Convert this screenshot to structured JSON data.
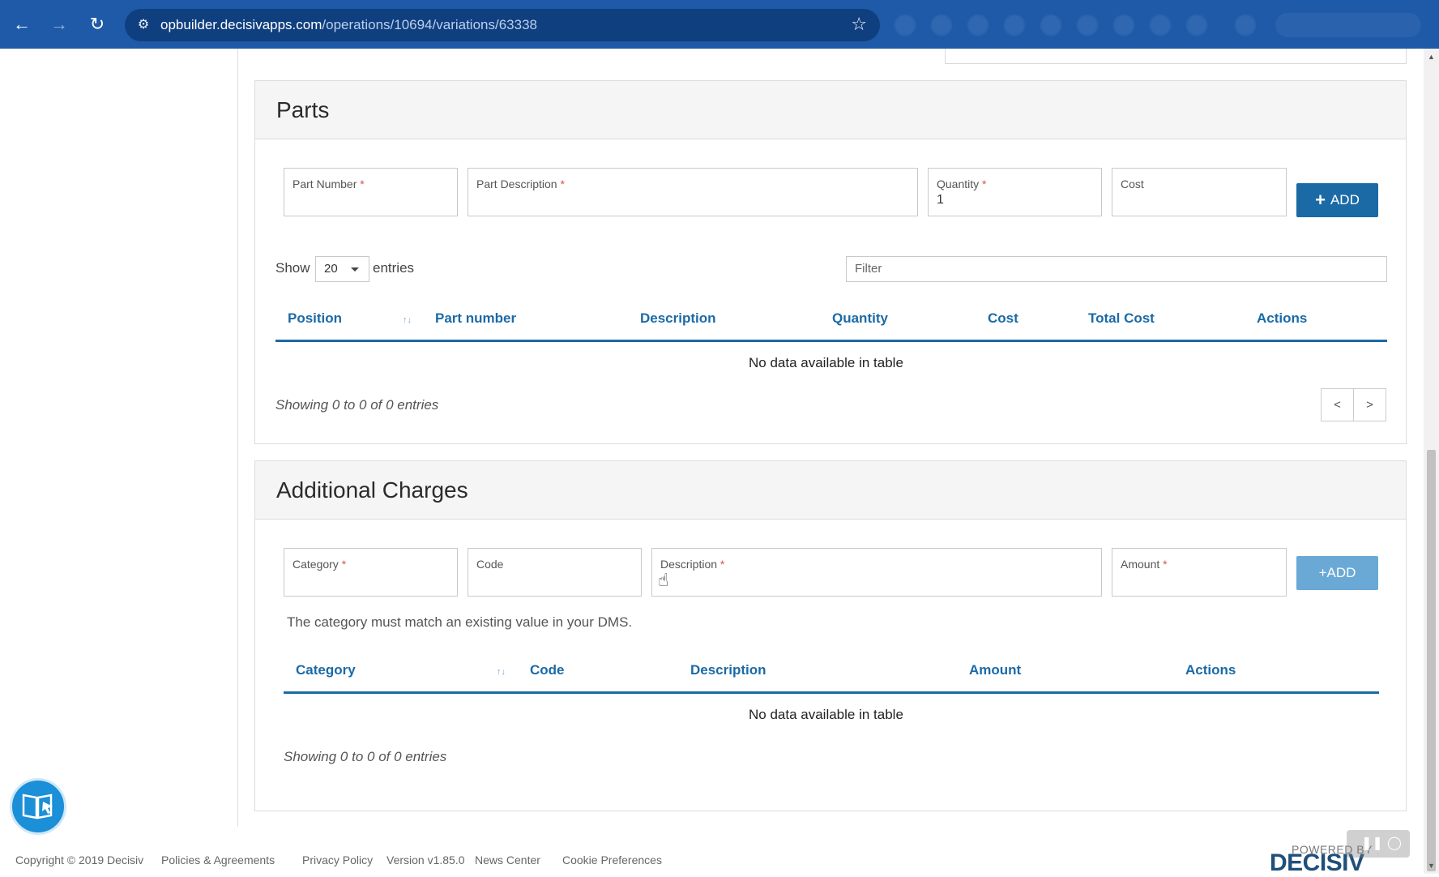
{
  "browser": {
    "url_host": "opbuilder.decisivapps.com",
    "url_path": "/operations/10694/variations/63338"
  },
  "parts": {
    "title": "Parts",
    "fields": {
      "part_number": "Part Number",
      "part_description": "Part Description",
      "quantity": "Quantity",
      "quantity_value": "1",
      "cost": "Cost",
      "required_mark": "*"
    },
    "add_label": "ADD",
    "show_label": "Show",
    "entries_label": "entries",
    "page_size": "20",
    "filter_placeholder": "Filter",
    "columns": [
      "Position",
      "Part number",
      "Description",
      "Quantity",
      "Cost",
      "Total Cost",
      "Actions"
    ],
    "empty_message": "No data available in table",
    "showing": "Showing 0 to 0 of 0 entries",
    "prev": "<",
    "next": ">"
  },
  "charges": {
    "title": "Additional Charges",
    "fields": {
      "category": "Category",
      "code": "Code",
      "description": "Description",
      "amount": "Amount",
      "required_mark": "*"
    },
    "add_label": "+ADD",
    "hint": "The category must match an existing value in your DMS.",
    "columns": [
      "Category",
      "Code",
      "Description",
      "Amount",
      "Actions"
    ],
    "empty_message": "No data available in table",
    "showing": "Showing 0 to 0 of 0 entries"
  },
  "footer": {
    "copyright": "Copyright © 2019 Decisiv",
    "policies": "Policies & Agreements",
    "privacy": "Privacy Policy",
    "version": "Version v1.85.0",
    "news": "News Center",
    "cookies": "Cookie Preferences",
    "powered_by": "POWERED BY",
    "brand": "DECISIV"
  },
  "colors": {
    "accent": "#1b6aa6",
    "chrome": "#1e5aa8",
    "required": "#d9534f"
  }
}
